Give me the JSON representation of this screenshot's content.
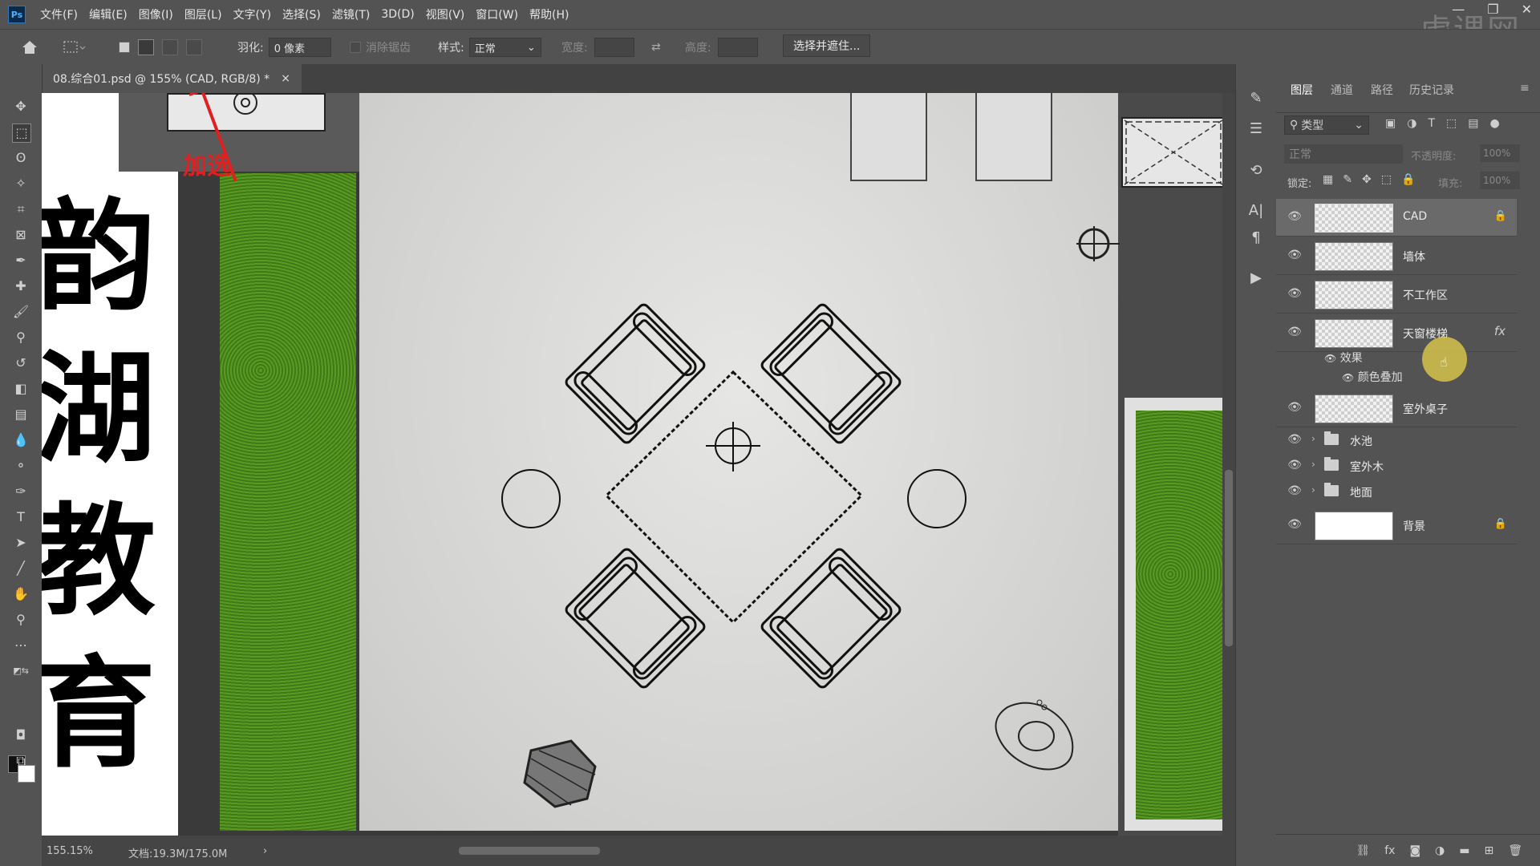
{
  "menubar": {
    "logo": "Ps",
    "items": [
      "文件(F)",
      "编辑(E)",
      "图像(I)",
      "图层(L)",
      "文字(Y)",
      "选择(S)",
      "滤镜(T)",
      "3D(D)",
      "视图(V)",
      "窗口(W)",
      "帮助(H)"
    ],
    "watermark": "虎课网",
    "window_controls": [
      "—",
      "❐",
      "✕"
    ]
  },
  "options": {
    "feather_label": "羽化:",
    "feather_value": "0 像素",
    "antialias_label": "消除锯齿",
    "style_label": "样式:",
    "style_value": "正常",
    "width_label": "宽度:",
    "height_label": "高度:",
    "select_mask_button": "选择并遮住..."
  },
  "document": {
    "tab_title": "08.综合01.psd @ 155% (CAD, RGB/8) *",
    "close": "×",
    "annotation": "加选",
    "side_text": [
      "韵",
      "湖",
      "教",
      "育"
    ]
  },
  "status": {
    "zoom": "155.15%",
    "doc_size": "文档:19.3M/175.0M"
  },
  "layers_panel": {
    "tabs": [
      "图层",
      "通道",
      "路径",
      "历史记录"
    ],
    "filter_label": "类型",
    "blend_mode": "正常",
    "opacity_label": "不透明度:",
    "opacity_value": "100%",
    "lock_label": "锁定:",
    "fill_label": "填充:",
    "fill_value": "100%",
    "layers": [
      {
        "name": "CAD",
        "locked": true
      },
      {
        "name": "墙体"
      },
      {
        "name": "不工作区"
      },
      {
        "name": "天窗楼梯",
        "fx": "fx"
      },
      {
        "name": "室外桌子"
      }
    ],
    "effects_label": "效果",
    "effect_item": "颜色叠加",
    "groups": [
      "水池",
      "室外木",
      "地面"
    ],
    "background": "背景"
  },
  "colors": {
    "accent_red": "#e02020",
    "grass": "#4d8a1e",
    "floor": "#d6d6d4",
    "cursor_highlight": "#e6d24a"
  }
}
